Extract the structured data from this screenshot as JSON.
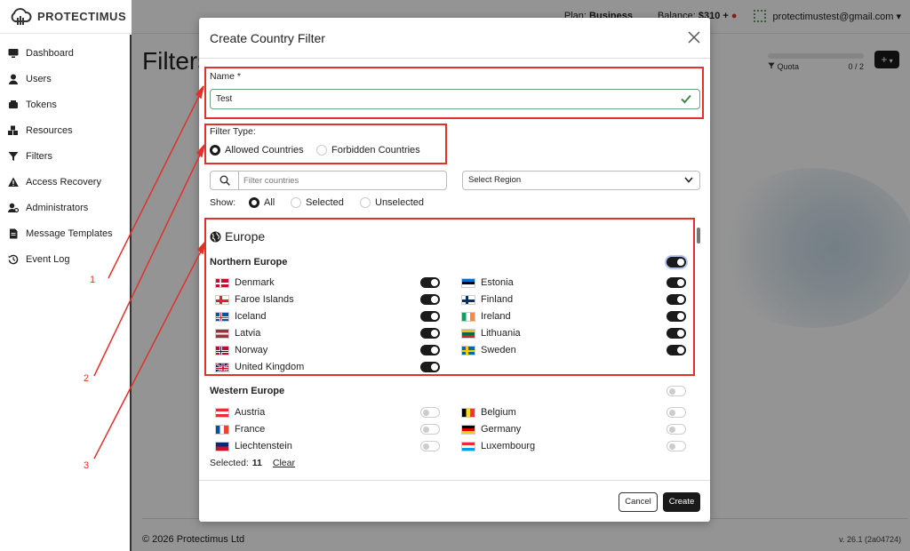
{
  "topbar": {
    "brand": "PROTECTIMUS",
    "plan_label": "Plan:",
    "plan_value": "Business",
    "balance_label": "Balance:",
    "balance_value": "$310",
    "user_email": "protectimustest@gmail.com"
  },
  "sidebar": {
    "items": [
      {
        "label": "Dashboard",
        "icon": "monitor-icon"
      },
      {
        "label": "Users",
        "icon": "user-icon"
      },
      {
        "label": "Tokens",
        "icon": "token-icon"
      },
      {
        "label": "Resources",
        "icon": "resources-icon"
      },
      {
        "label": "Filters",
        "icon": "filter-icon"
      },
      {
        "label": "Access Recovery",
        "icon": "warning-icon"
      },
      {
        "label": "Administrators",
        "icon": "admin-icon"
      },
      {
        "label": "Message Templates",
        "icon": "document-icon"
      },
      {
        "label": "Event Log",
        "icon": "history-icon"
      }
    ]
  },
  "main": {
    "page_title": "Filters",
    "quota_label": "Quota",
    "quota_count": "0 / 2",
    "add_button": "+"
  },
  "footer": {
    "copyright": "© 2026 Protectimus Ltd",
    "version": "v. 26.1 (2a04724)"
  },
  "modal": {
    "title": "Create Country Filter",
    "name_label": "Name *",
    "name_value": "Test",
    "filter_type_label": "Filter Type:",
    "filter_types": [
      {
        "label": "Allowed Countries",
        "selected": true
      },
      {
        "label": "Forbidden Countries",
        "selected": false
      }
    ],
    "search_placeholder": "Filter countries",
    "region_select": "Select Region",
    "show_label": "Show:",
    "show_options": [
      {
        "label": "All",
        "selected": true
      },
      {
        "label": "Selected",
        "selected": false
      },
      {
        "label": "Unselected",
        "selected": false
      }
    ],
    "region_name": "Europe",
    "subregions": [
      {
        "name": "Northern Europe",
        "enabled": true,
        "countries": [
          {
            "name": "Denmark",
            "enabled": true
          },
          {
            "name": "Estonia",
            "enabled": true
          },
          {
            "name": "Faroe Islands",
            "enabled": true
          },
          {
            "name": "Finland",
            "enabled": true
          },
          {
            "name": "Iceland",
            "enabled": true
          },
          {
            "name": "Ireland",
            "enabled": true
          },
          {
            "name": "Latvia",
            "enabled": true
          },
          {
            "name": "Lithuania",
            "enabled": true
          },
          {
            "name": "Norway",
            "enabled": true
          },
          {
            "name": "Sweden",
            "enabled": true
          },
          {
            "name": "United Kingdom",
            "enabled": true
          }
        ]
      },
      {
        "name": "Western Europe",
        "enabled": false,
        "countries": [
          {
            "name": "Austria",
            "enabled": false
          },
          {
            "name": "Belgium",
            "enabled": false
          },
          {
            "name": "France",
            "enabled": false
          },
          {
            "name": "Germany",
            "enabled": false
          },
          {
            "name": "Liechtenstein",
            "enabled": false
          },
          {
            "name": "Luxembourg",
            "enabled": false
          }
        ]
      }
    ],
    "selected_label": "Selected:",
    "selected_count": "11",
    "clear_label": "Clear",
    "cancel_label": "Cancel",
    "create_label": "Create"
  },
  "annotations": [
    "1",
    "2",
    "3"
  ],
  "colors": {
    "annotation": "#e0322a",
    "toggle_on": "#1a1a1a",
    "valid_border": "#6fa27a"
  }
}
